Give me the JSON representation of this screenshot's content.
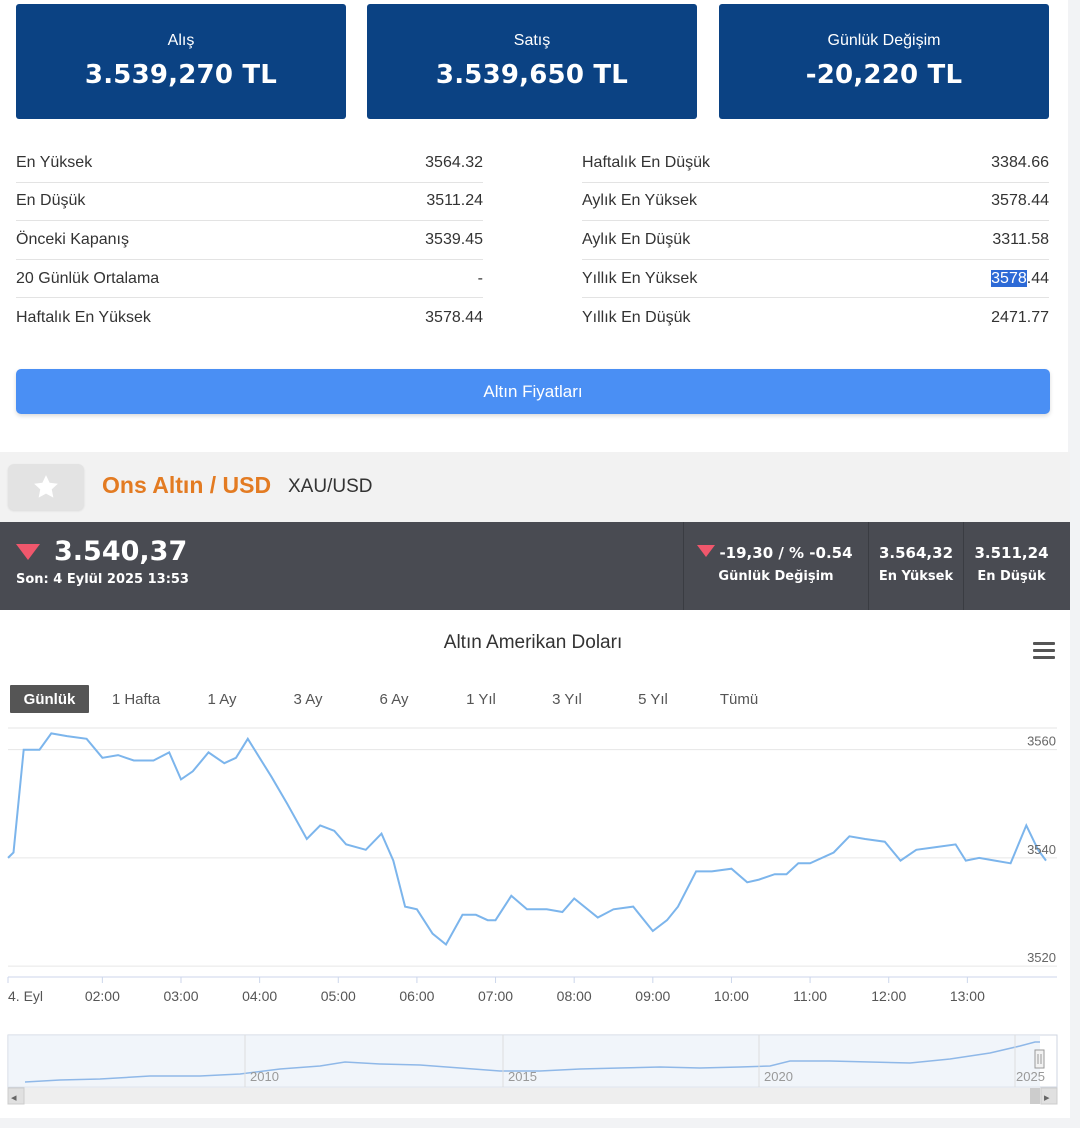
{
  "price_boxes": [
    {
      "label": "Alış",
      "value": "3.539,270 TL"
    },
    {
      "label": "Satış",
      "value": "3.539,650 TL"
    },
    {
      "label": "Günlük Değişim",
      "value": "-20,220 TL"
    }
  ],
  "stats_left": [
    {
      "label": "En Yüksek",
      "value": "3564.32"
    },
    {
      "label": "En Düşük",
      "value": "3511.24"
    },
    {
      "label": "Önceki Kapanış",
      "value": "3539.45"
    },
    {
      "label": "20 Günlük Ortalama",
      "value": "-"
    },
    {
      "label": "Haftalık En Yüksek",
      "value": "3578.44"
    }
  ],
  "stats_right": [
    {
      "label": "Haftalık En Düşük",
      "value": "3384.66"
    },
    {
      "label": "Aylık En Yüksek",
      "value": "3578.44"
    },
    {
      "label": "Aylık En Düşük",
      "value": "3311.58"
    },
    {
      "label": "Yıllık En Yüksek",
      "value_highlighted": "3578",
      "value_rest": ".44"
    },
    {
      "label": "Yıllık En Düşük",
      "value": "2471.77"
    }
  ],
  "gold_prices_button": "Altın Fiyatları",
  "instrument": {
    "title": "Ons Altın / USD",
    "symbol": "XAU/USD",
    "price": "3.540,37",
    "last_update": "Son: 4 Eylül 2025 13:53",
    "change_value": "-19,30 / % -0.54",
    "change_label": "Günlük Değişim",
    "high_value": "3.564,32",
    "high_label": "En Yüksek",
    "low_value": "3.511,24",
    "low_label": "En Düşük",
    "down_color": "#f0576c"
  },
  "range_buttons": [
    "Günlük",
    "1 Hafta",
    "1 Ay",
    "3 Ay",
    "6 Ay",
    "1 Yıl",
    "3 Yıl",
    "5 Yıl",
    "Tümü"
  ],
  "active_range": "Günlük",
  "chart_data": {
    "type": "line",
    "title": "Altın Amerikan Doları",
    "x_tick_labels": [
      "4. Eyl",
      "02:00",
      "03:00",
      "04:00",
      "05:00",
      "06:00",
      "07:00",
      "08:00",
      "09:00",
      "10:00",
      "11:00",
      "12:00",
      "13:00"
    ],
    "y_tick_labels": [
      "3560",
      "3540",
      "3520"
    ],
    "ylim": [
      3518,
      3564
    ],
    "xlim_hours": [
      0.8,
      14.0
    ],
    "grid": "horizontal",
    "series_color": "#7cb5ec",
    "x_hours": [
      0.8,
      0.87,
      1.0,
      1.2,
      1.35,
      1.55,
      1.8,
      2.0,
      2.2,
      2.4,
      2.65,
      2.85,
      3.0,
      3.15,
      3.35,
      3.55,
      3.7,
      3.85,
      4.0,
      4.15,
      4.35,
      4.6,
      4.77,
      4.95,
      5.1,
      5.35,
      5.55,
      5.7,
      5.85,
      6.0,
      6.2,
      6.37,
      6.58,
      6.75,
      6.9,
      7.0,
      7.2,
      7.4,
      7.65,
      7.85,
      8.0,
      8.3,
      8.5,
      8.75,
      9.0,
      9.18,
      9.32,
      9.55,
      9.75,
      10.0,
      10.2,
      10.35,
      10.55,
      10.7,
      10.85,
      11.0,
      11.3,
      11.5,
      11.7,
      11.95,
      12.15,
      12.35,
      12.6,
      12.85,
      12.98,
      13.15,
      13.35,
      13.55,
      13.75,
      13.9,
      14.0
    ],
    "values": [
      3540,
      3541,
      3560,
      3560,
      3563,
      3562.5,
      3562,
      3558.5,
      3559,
      3558,
      3558,
      3559.5,
      3554.5,
      3556,
      3559.5,
      3557.5,
      3558.5,
      3562,
      3558.5,
      3555,
      3550,
      3543.5,
      3546,
      3545,
      3542.5,
      3541.5,
      3544.5,
      3539.5,
      3531,
      3530.5,
      3526,
      3524,
      3529.5,
      3529.5,
      3528.5,
      3528.5,
      3533,
      3530.5,
      3530.5,
      3530,
      3532.5,
      3529,
      3530.5,
      3531,
      3526.5,
      3528.5,
      3531,
      3537.5,
      3537.5,
      3538,
      3535.5,
      3536,
      3537,
      3537,
      3539,
      3539,
      3541,
      3544,
      3543.5,
      3543,
      3539.5,
      3541.5,
      3542,
      3542.5,
      3539.5,
      3540,
      3539.5,
      3539,
      3546,
      3541.5,
      3539.5
    ]
  },
  "navigator": {
    "year_labels": [
      "2010",
      "2015",
      "2020",
      "2025"
    ],
    "scroll_left": "◂",
    "scroll_right": "▸"
  }
}
